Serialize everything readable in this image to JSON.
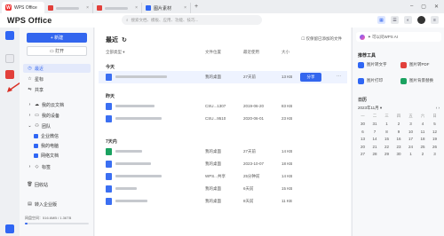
{
  "titlebar": {
    "app_tab": "WPS Office",
    "tab2_color": "#e2403b",
    "tab3_color": "#e2403b",
    "tab4_label": "图片素材",
    "tab4_color": "#2f66f4"
  },
  "header": {
    "brand": "WPS Office",
    "search_placeholder": "搜索文档、模板、应用、功能、技巧..."
  },
  "sidebar": {
    "new_label": "+ 新建",
    "open_label": "打开",
    "items": [
      {
        "label": "最近",
        "icon": "clock-icon"
      },
      {
        "label": "星标",
        "icon": "star-icon"
      },
      {
        "label": "共享",
        "icon": "share-icon"
      },
      {
        "label": "我的云文档",
        "icon": "cloud-icon"
      },
      {
        "label": "我的设备",
        "icon": "device-icon"
      },
      {
        "label": "团队",
        "icon": "team-icon"
      },
      {
        "label": "企业微信",
        "icon": "wecom-icon"
      },
      {
        "label": "我的电脑",
        "icon": "computer-icon"
      },
      {
        "label": "网络文档",
        "icon": "network-icon"
      },
      {
        "label": "标签",
        "icon": "tag-icon"
      },
      {
        "label": "回收站",
        "icon": "trash-icon"
      },
      {
        "label": "转入企业版",
        "icon": "enterprise-icon"
      }
    ],
    "storage_text": "网盘空间：516.6MB / 1.36TB",
    "storage_fraction": 0.04
  },
  "main": {
    "title": "最近",
    "option_label": "☐ 仅保留已添加的文件",
    "columns": [
      "全部类型 ▾",
      "文件位置",
      "最近使用",
      "大小"
    ],
    "groups": [
      "今天",
      "昨天",
      "7天内"
    ],
    "rows": [
      {
        "location": "我的桌面",
        "time": "27天前",
        "size": "13 KB",
        "color": "#3b6ff2",
        "highlight": true
      },
      {
        "location": "CSU...1307",
        "time": "2019-06-20",
        "size": "83 KB",
        "color": "#3b6ff2",
        "highlight": false
      },
      {
        "location": "CSU...9510",
        "time": "2020-06-01",
        "size": "23 KB",
        "color": "#3b6ff2",
        "highlight": false
      },
      {
        "location": "我的桌面",
        "time": "27天前",
        "size": "14 KB",
        "color": "#1aa260",
        "highlight": false
      },
      {
        "location": "我的桌面",
        "time": "2023-10-07",
        "size": "18 KB",
        "color": "#3b6ff2",
        "highlight": false
      },
      {
        "location": "WPS...共享",
        "time": "25分钟前",
        "size": "14 KB",
        "color": "#3b6ff2",
        "highlight": false
      },
      {
        "location": "我的桌面",
        "time": "6天前",
        "size": "15 KB",
        "color": "#3b6ff2",
        "highlight": false
      },
      {
        "location": "我的桌面",
        "time": "8天前",
        "size": "11 KB",
        "color": "#3b6ff2",
        "highlight": false
      }
    ],
    "share_label": "分享"
  },
  "right_panel": {
    "ai_prompt": "✦ 可以问WPS AI",
    "tools_title": "推荐工具",
    "tools": [
      {
        "label": "图片转文字",
        "color": "#2f66f4"
      },
      {
        "label": "图片转PDF",
        "color": "#e2403b"
      },
      {
        "label": "图片打印",
        "color": "#2f66f4"
      },
      {
        "label": "图片背景替换",
        "color": "#1aa260"
      }
    ],
    "cal_title": "日历",
    "cal_month": "2023年11月 ▾",
    "cal_nav": "‹ ›",
    "weekdays": [
      "一",
      "二",
      "三",
      "四",
      "五",
      "六",
      "日"
    ],
    "weeks": [
      [
        "30",
        "31",
        "1",
        "2",
        "3",
        "4",
        "5"
      ],
      [
        "6",
        "7",
        "8",
        "9",
        "10",
        "11",
        "12"
      ],
      [
        "13",
        "14",
        "15",
        "16",
        "17",
        "18",
        "19"
      ],
      [
        "20",
        "21",
        "22",
        "23",
        "24",
        "25",
        "26"
      ],
      [
        "27",
        "28",
        "29",
        "30",
        "1",
        "2",
        "3"
      ]
    ]
  }
}
